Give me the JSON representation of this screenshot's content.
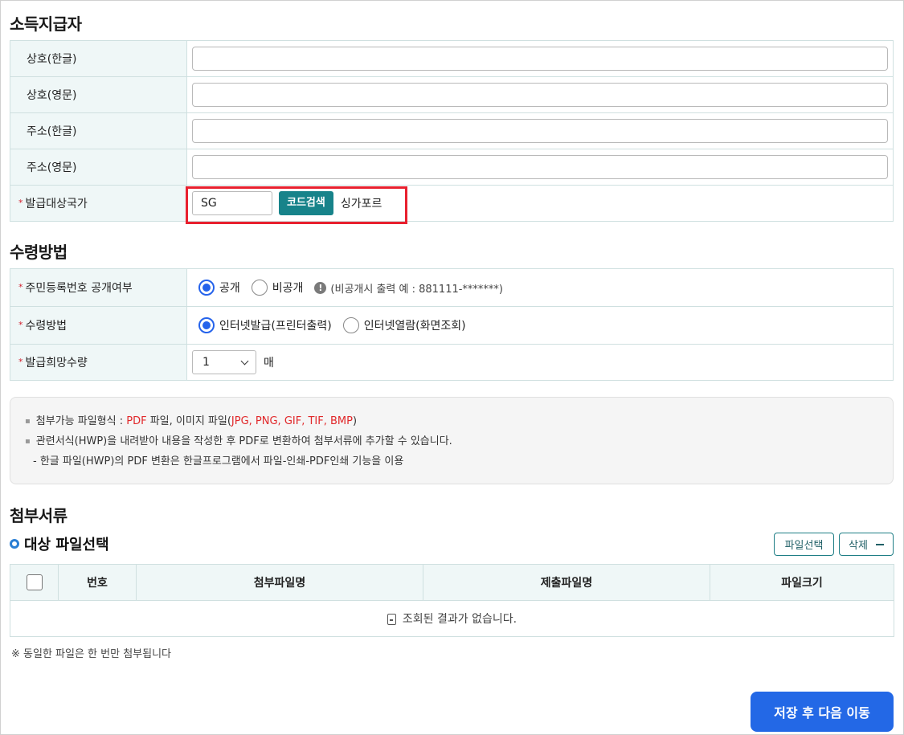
{
  "issuer": {
    "title": "소득지급자",
    "fields": [
      {
        "label": "상호(한글)",
        "value": ""
      },
      {
        "label": "상호(영문)",
        "value": ""
      },
      {
        "label": "주소(한글)",
        "value": ""
      },
      {
        "label": "주소(영문)",
        "value": ""
      }
    ],
    "country": {
      "required_mark": "*",
      "label": "발급대상국가",
      "code_value": "SG",
      "search_button": "코드검색",
      "country_name": "싱가포르"
    }
  },
  "receipt": {
    "title": "수령방법",
    "rrn_disclosure": {
      "required_mark": "*",
      "label": "주민등록번호 공개여부",
      "options": [
        "공개",
        "비공개"
      ],
      "selected": "공개",
      "info_icon": "!",
      "hint": "(비공개시 출력 예 : 881111-*******)"
    },
    "method": {
      "required_mark": "*",
      "label": "수령방법",
      "options": [
        "인터넷발급(프린터출력)",
        "인터넷열람(화면조회)"
      ],
      "selected": "인터넷발급(프린터출력)"
    },
    "quantity": {
      "required_mark": "*",
      "label": "발급희망수량",
      "selected_value": "1",
      "unit": "매"
    }
  },
  "notice": {
    "line1_prefix": "첨부가능 파일형식 : ",
    "line1_pdf": "PDF",
    "line1_middle": " 파일, 이미지 파일(",
    "line1_images": "JPG, PNG, GIF, TIF, BMP",
    "line1_suffix": ")",
    "line2": "관련서식(HWP)을 내려받아 내용을 작성한 후 PDF로 변환하여 첨부서류에 추가할 수 있습니다.",
    "line3": "- 한글 파일(HWP)의 PDF 변환은 한글프로그램에서 파일-인쇄-PDF인쇄 기능을 이용"
  },
  "attachments": {
    "title": "첨부서류",
    "subtitle": "대상 파일선택",
    "select_button": "파일선택",
    "delete_button": "삭제",
    "columns": [
      "번호",
      "첨부파일명",
      "제출파일명",
      "파일크기"
    ],
    "empty_message": "조회된 결과가 없습니다.",
    "footnote": "※ 동일한 파일은 한 번만 첨부됩니다"
  },
  "save_button": "저장 후 다음 이동",
  "colors": {
    "accent_teal": "#17838a",
    "primary_blue": "#2368e6",
    "required_red": "#d3202e",
    "highlight_red": "#e8202e"
  }
}
